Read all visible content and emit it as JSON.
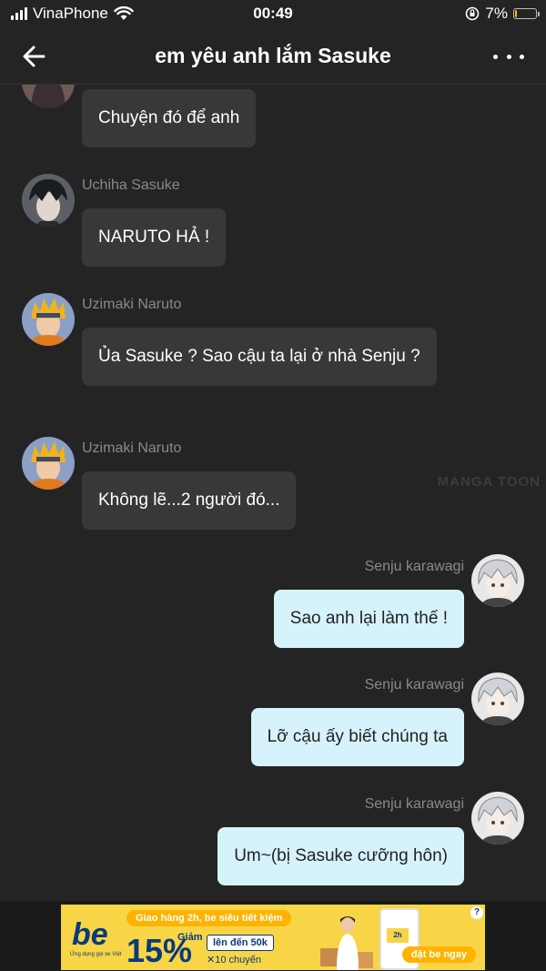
{
  "status_bar": {
    "carrier": "VinaPhone",
    "time": "00:49",
    "battery_percent": "7%",
    "battery_level": 0.07
  },
  "header": {
    "title": "em yêu anh lắm Sasuke"
  },
  "messages": [
    {
      "sender": "",
      "text": "Chuyện đó để anh",
      "direction": "in",
      "avatar": "hinata-avatar"
    },
    {
      "sender": "Uchiha Sasuke",
      "text": "NARUTO HẢ !",
      "direction": "in",
      "avatar": "sasuke-avatar"
    },
    {
      "sender": "Uzimaki Naruto",
      "text": "Ủa Sasuke ? Sao cậu ta lại ở nhà Senju ?",
      "direction": "in",
      "avatar": "naruto-avatar"
    },
    {
      "sender": "Uzimaki Naruto",
      "text": "Không lẽ...2 người đó...",
      "direction": "in",
      "avatar": "naruto-avatar"
    },
    {
      "sender": "Senju karawagi",
      "text": "Sao anh lại làm thế !",
      "direction": "out",
      "avatar": "senju-avatar"
    },
    {
      "sender": "Senju karawagi",
      "text": "Lỡ cậu ấy biết chúng ta",
      "direction": "out",
      "avatar": "senju-avatar"
    },
    {
      "sender": "Senju karawagi",
      "text": "Um~(bị Sasuke cưỡng hôn)",
      "direction": "out",
      "avatar": "senju-avatar"
    }
  ],
  "watermark": "MANGA TOON",
  "ad": {
    "logo": "be",
    "logo_sub": "Ứng dụng gọi xe Việt",
    "banner": "Giao hàng 2h, be siêu tiết kiệm",
    "discount_label": "Giảm",
    "discount": "15%",
    "up_to": "lên đến 50k",
    "times": "✕10 chuyến",
    "phone_tag": "2h",
    "cta": "đặt be ngay",
    "info": "?"
  },
  "colors": {
    "background": "#242424",
    "incoming_bubble": "#383838",
    "outgoing_bubble": "#d6f3fc",
    "sender_text": "#8a8a8a",
    "battery": "#f2c300"
  }
}
